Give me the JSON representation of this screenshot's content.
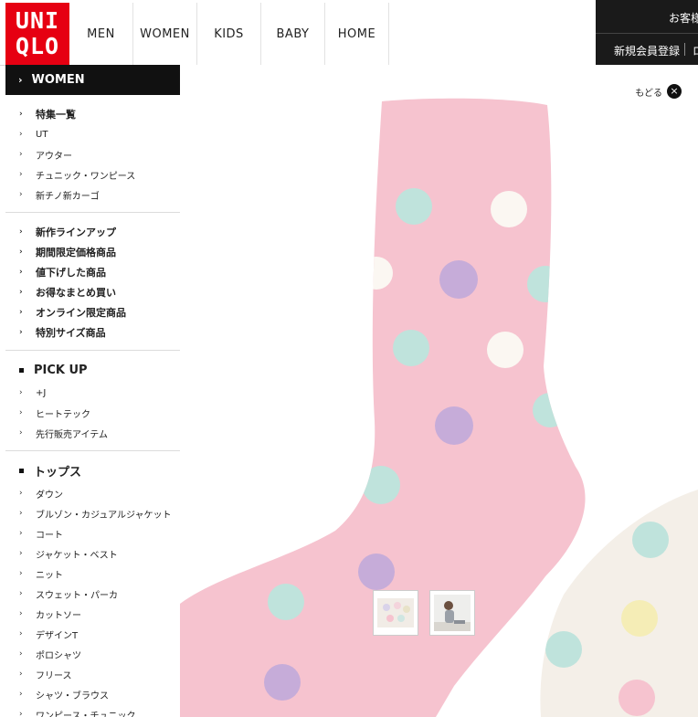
{
  "header": {
    "logo_line1": "UNI",
    "logo_line2": "QLO",
    "nav": [
      "MEN",
      "WOMEN",
      "KIDS",
      "BABY",
      "HOME"
    ],
    "util_top": "お客様",
    "util_register": "新規会員登録",
    "util_login": "ロ"
  },
  "sidebar": {
    "heading": "WOMEN",
    "section1": [
      "特集一覧",
      "UT",
      "アウター",
      "チュニック・ワンピース",
      "新チノ新カーゴ"
    ],
    "section2": [
      "新作ラインアップ",
      "期間限定価格商品",
      "値下げした商品",
      "お得なまとめ買い",
      "オンライン限定商品",
      "特別サイズ商品"
    ],
    "pickup": {
      "title": "PICK UP",
      "items": [
        "+J",
        "ヒートテック",
        "先行販売アイテム"
      ]
    },
    "tops": {
      "title": "トップス",
      "items": [
        "ダウン",
        "ブルゾン・カジュアルジャケット",
        "コート",
        "ジャケット・ベスト",
        "ニット",
        "スウェット・パーカ",
        "カットソー",
        "デザインT",
        "ポロシャツ",
        "フリース",
        "シャツ・ブラウス",
        "ワンピース・チュニック"
      ]
    }
  },
  "main": {
    "back_label": "もどる",
    "colors": {
      "sock_pink": "#f6c3cf",
      "sock_white": "#f4efe8",
      "dot_mint": "#bfe3dc",
      "dot_lilac": "#c6acd9",
      "dot_white": "#fbf7f2",
      "dot_yellow": "#f5edb6",
      "brand_red": "#e60012"
    }
  }
}
